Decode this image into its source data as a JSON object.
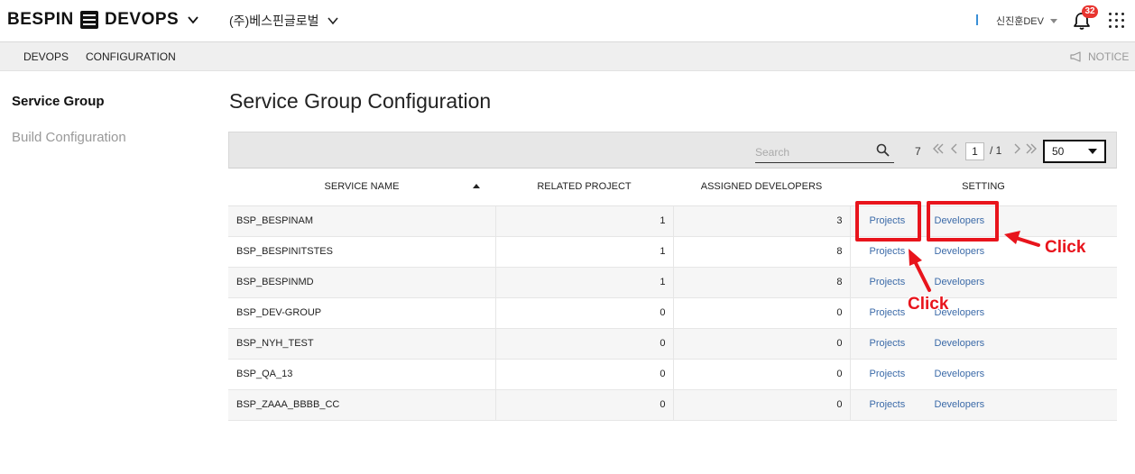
{
  "header": {
    "brand": "BESPIN",
    "product": "DEVOPS",
    "organization": "(주)베스핀글로벌",
    "user": "신진훈DEV",
    "notification_count": "32",
    "icons": [
      "dashboard-icon",
      "chevron-down-icon",
      "bell-icon",
      "apps-grid-icon"
    ]
  },
  "subnav": {
    "items": [
      "DEVOPS",
      "CONFIGURATION"
    ],
    "notice": "NOTICE"
  },
  "sidebar": {
    "items": [
      {
        "label": "Service Group",
        "active": true
      },
      {
        "label": "Build Configuration",
        "active": false
      }
    ]
  },
  "main": {
    "title": "Service Group Configuration",
    "toolbar": {
      "search_placeholder": "Search",
      "total_count": "7",
      "current_page": "1",
      "page_total": "/ 1",
      "page_size": "50"
    },
    "table": {
      "columns": [
        "SERVICE NAME",
        "RELATED PROJECT",
        "ASSIGNED DEVELOPERS",
        "SETTING"
      ],
      "sort": {
        "column": "SERVICE NAME",
        "direction": "asc"
      },
      "rows": [
        {
          "name": "BSP_BESPINAM",
          "related_project": "1",
          "assigned_developers": "3",
          "projects_link": "Projects",
          "developers_link": "Developers"
        },
        {
          "name": "BSP_BESPINITSTES",
          "related_project": "1",
          "assigned_developers": "8",
          "projects_link": "Projects",
          "developers_link": "Developers"
        },
        {
          "name": "BSP_BESPINMD",
          "related_project": "1",
          "assigned_developers": "8",
          "projects_link": "Projects",
          "developers_link": "Developers"
        },
        {
          "name": "BSP_DEV-GROUP",
          "related_project": "0",
          "assigned_developers": "0",
          "projects_link": "Projects",
          "developers_link": "Developers"
        },
        {
          "name": "BSP_NYH_TEST",
          "related_project": "0",
          "assigned_developers": "0",
          "projects_link": "Projects",
          "developers_link": "Developers"
        },
        {
          "name": "BSP_QA_13",
          "related_project": "0",
          "assigned_developers": "0",
          "projects_link": "Projects",
          "developers_link": "Developers"
        },
        {
          "name": "BSP_ZAAA_BBBB_CC",
          "related_project": "0",
          "assigned_developers": "0",
          "projects_link": "Projects",
          "developers_link": "Developers"
        }
      ]
    }
  },
  "annotations": {
    "click_right": "Click",
    "click_below": "Click",
    "color": "#e8141c"
  },
  "colors": {
    "link": "#3b6aa8",
    "badge": "#e8342f",
    "highlight": "#e8141c"
  }
}
